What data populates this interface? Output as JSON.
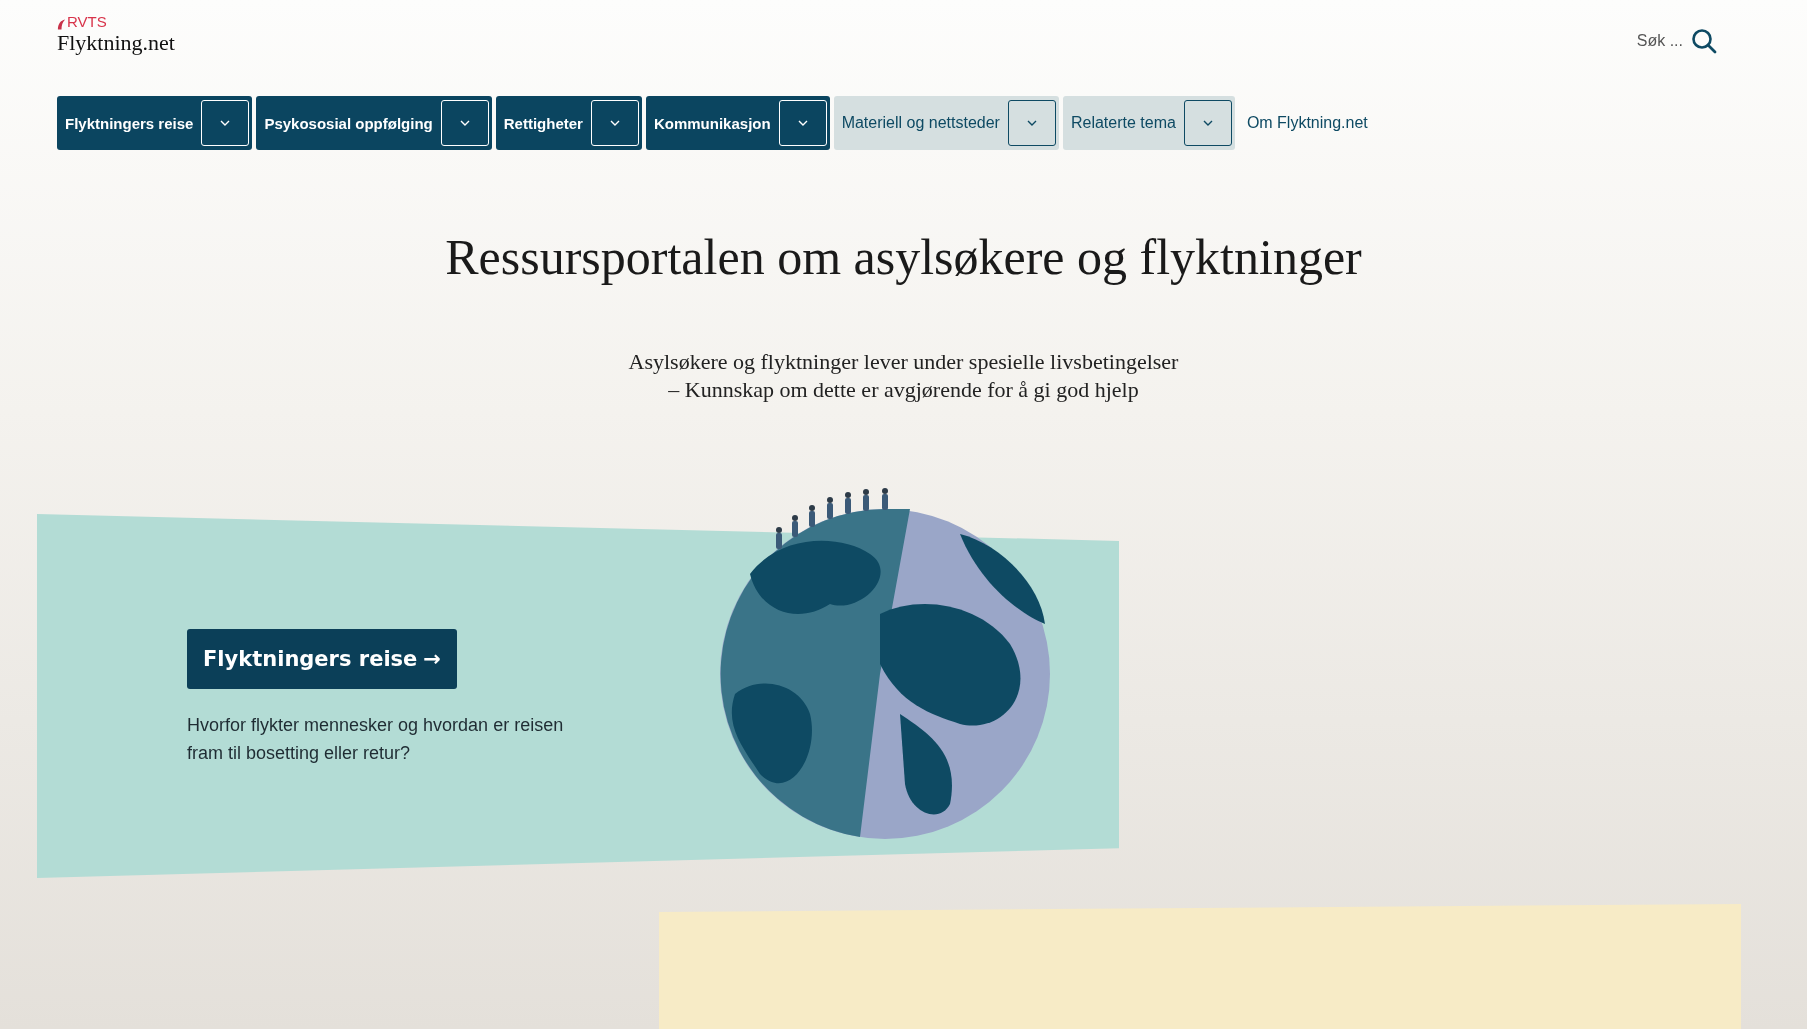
{
  "logo": {
    "mark": "RVTS",
    "name": "Flyktning.net"
  },
  "search": {
    "placeholder": "Søk ..."
  },
  "nav": [
    {
      "label": "Flyktningers reise",
      "kind": "primary"
    },
    {
      "label": "Psykososial oppfølging",
      "kind": "primary"
    },
    {
      "label": "Rettigheter",
      "kind": "primary"
    },
    {
      "label": "Kommunikasjon",
      "kind": "primary"
    },
    {
      "label": "Materiell og nettsteder",
      "kind": "secondary"
    },
    {
      "label": "Relaterte tema",
      "kind": "secondary"
    },
    {
      "label": "Om Flyktning.net",
      "kind": "link"
    }
  ],
  "hero": {
    "title": "Ressursportalen om asylsøkere og flyktninger",
    "subtitle": [
      "Asylsøkere og flyktninger lever under spesielle livsbetingelser",
      "– Kunnskap om dette er avgjørende for å gi god hjelp"
    ]
  },
  "feature": {
    "button": "Flyktningers reise",
    "arrow": "→",
    "text": "Hvorfor flykter mennesker og hvordan er reisen fram til bosetting eller retur?"
  }
}
